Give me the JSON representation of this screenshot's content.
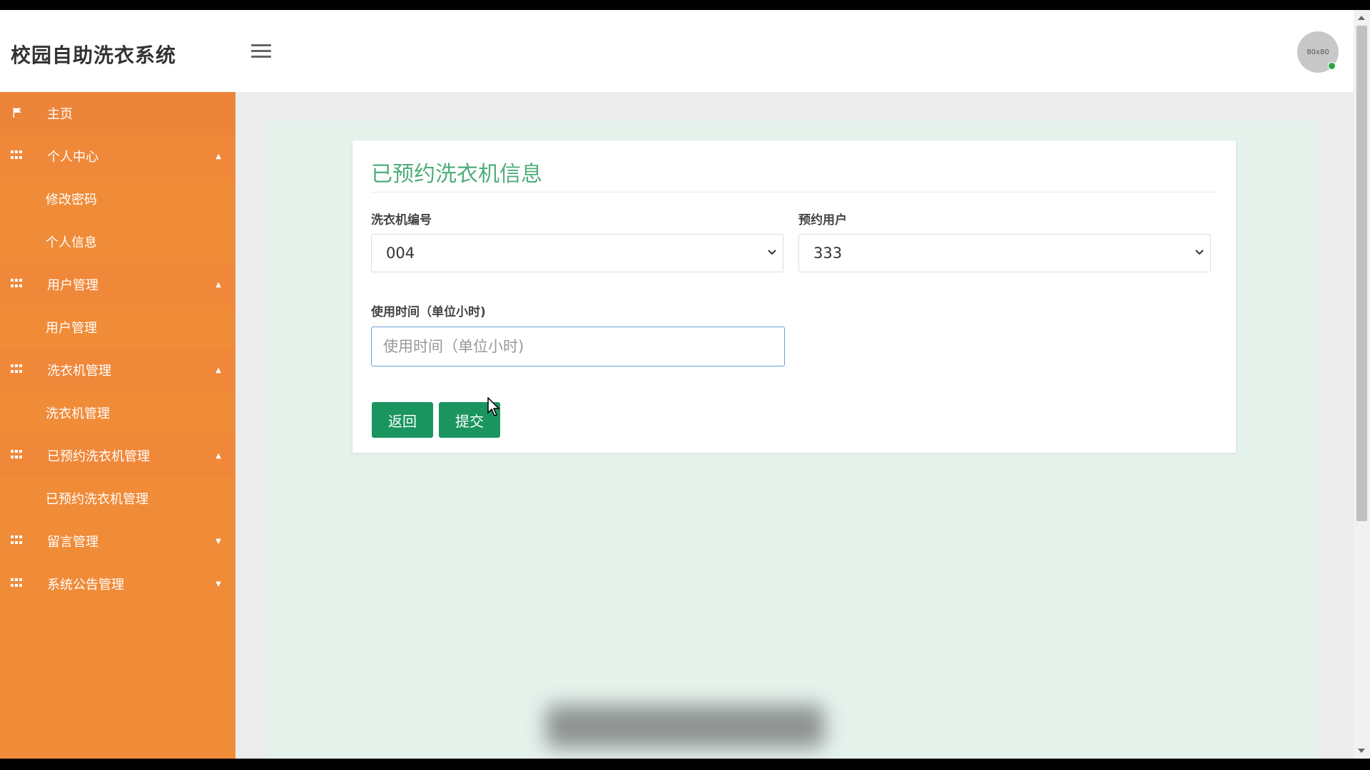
{
  "header": {
    "brand": "校园自助洗衣系统",
    "avatar_text": "80x80"
  },
  "sidebar": {
    "items": [
      {
        "label": "主页",
        "icon": "flag-icon",
        "expandable": false
      },
      {
        "label": "个人中心",
        "icon": "grid-icon",
        "expanded": true,
        "children": [
          "修改密码",
          "个人信息"
        ]
      },
      {
        "label": "用户管理",
        "icon": "grid-icon",
        "expanded": true,
        "children": [
          "用户管理"
        ]
      },
      {
        "label": "洗衣机管理",
        "icon": "grid-icon",
        "expanded": true,
        "children": [
          "洗衣机管理"
        ]
      },
      {
        "label": "已预约洗衣机管理",
        "icon": "grid-icon",
        "expanded": true,
        "children": [
          "已预约洗衣机管理"
        ]
      },
      {
        "label": "留言管理",
        "icon": "grid-icon",
        "expanded": false
      },
      {
        "label": "系统公告管理",
        "icon": "grid-icon",
        "expanded": false
      }
    ]
  },
  "form": {
    "title": "已预约洗衣机信息",
    "machine_label": "洗衣机编号",
    "machine_value": "004",
    "user_label": "预约用户",
    "user_value": "333",
    "time_label": "使用时间（单位小时)",
    "time_placeholder": "使用时间（单位小时)",
    "time_value": "",
    "back_button": "返回",
    "submit_button": "提交"
  },
  "colors": {
    "sidebar": "#f08b38",
    "title_green": "#4fad7a",
    "button_green": "#1a9560",
    "content_bg": "#e5f2ec"
  }
}
